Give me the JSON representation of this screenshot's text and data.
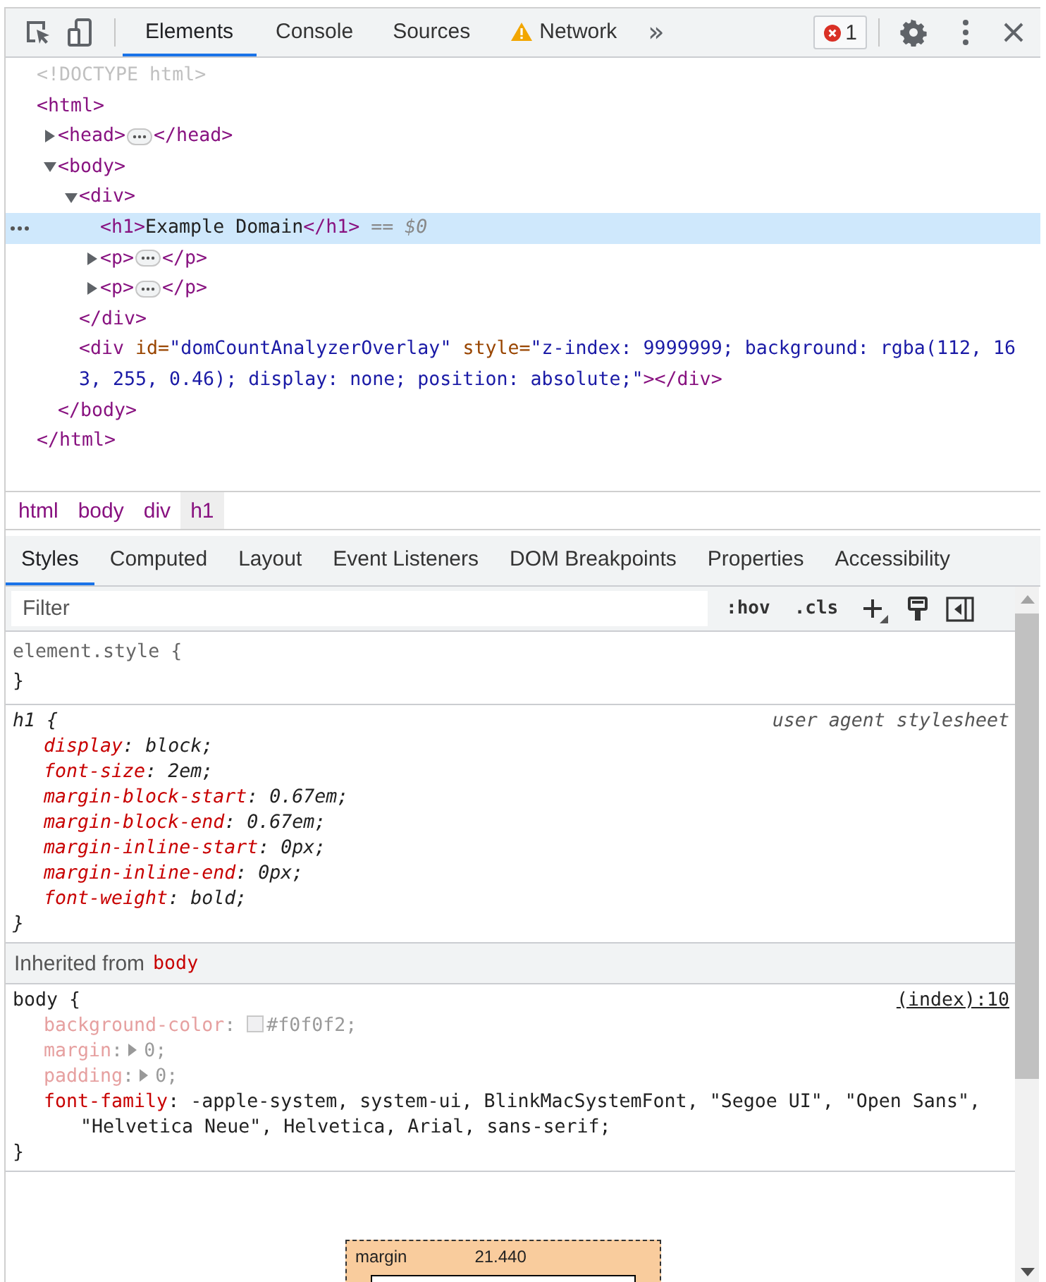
{
  "toolbar": {
    "tabs": [
      {
        "label": "Elements",
        "selected": true,
        "kind": "plain"
      },
      {
        "label": "Console",
        "selected": false,
        "kind": "plain"
      },
      {
        "label": "Sources",
        "selected": false,
        "kind": "plain"
      },
      {
        "label": "Network",
        "selected": false,
        "kind": "warning"
      }
    ],
    "more": "»",
    "error_count": "1"
  },
  "dom_tree": [
    {
      "selected": false,
      "parts": [
        {
          "kind": "doctype",
          "text": "<!DOCTYPE html>"
        }
      ]
    },
    {
      "selected": false,
      "parts": [
        {
          "kind": "tag",
          "text": "<html>"
        }
      ],
      "closing": [
        {
          "kind": "tag",
          "text": "</html>"
        }
      ],
      "children": [
        {
          "expanded": false,
          "selected": false,
          "parts": [
            {
              "kind": "tag",
              "text": "<head>"
            },
            {
              "kind": "ellipsis"
            },
            {
              "kind": "tag",
              "text": "</head>"
            }
          ]
        },
        {
          "expanded": true,
          "selected": false,
          "parts": [
            {
              "kind": "tag",
              "text": "<body>"
            }
          ],
          "closing": [
            {
              "kind": "tag",
              "text": "</body>"
            }
          ],
          "children": [
            {
              "expanded": true,
              "selected": false,
              "parts": [
                {
                  "kind": "tag",
                  "text": "<div>"
                }
              ],
              "closing": [
                {
                  "kind": "tag",
                  "text": "</div>"
                }
              ],
              "children": [
                {
                  "selected": true,
                  "parts": [
                    {
                      "kind": "tag",
                      "text": "<h1>"
                    },
                    {
                      "kind": "text",
                      "text": "Example Domain"
                    },
                    {
                      "kind": "tag",
                      "text": "</h1>"
                    },
                    {
                      "kind": "ref",
                      "text": " == $0"
                    }
                  ]
                },
                {
                  "expanded": false,
                  "selected": false,
                  "parts": [
                    {
                      "kind": "tag",
                      "text": "<p>"
                    },
                    {
                      "kind": "ellipsis"
                    },
                    {
                      "kind": "tag",
                      "text": "</p>"
                    }
                  ]
                },
                {
                  "expanded": false,
                  "selected": false,
                  "parts": [
                    {
                      "kind": "tag",
                      "text": "<p>"
                    },
                    {
                      "kind": "ellipsis"
                    },
                    {
                      "kind": "tag",
                      "text": "</p>"
                    }
                  ]
                }
              ]
            },
            {
              "selected": false,
              "parts": [
                {
                  "kind": "tag",
                  "text": "<div"
                },
                {
                  "kind": "attr",
                  "text": " id="
                },
                {
                  "kind": "value",
                  "text": "\"domCountAnalyzerOverlay\""
                },
                {
                  "kind": "attr",
                  "text": " style="
                },
                {
                  "kind": "value",
                  "text": "\"z-index: 9999999; background: rgba(112, 163, 255, 0.46); display: none; position: absolute;\""
                },
                {
                  "kind": "tag",
                  "text": "></div>"
                }
              ]
            }
          ]
        }
      ]
    }
  ],
  "breadcrumbs": [
    {
      "label": "html",
      "selected": false
    },
    {
      "label": "body",
      "selected": false
    },
    {
      "label": "div",
      "selected": false
    },
    {
      "label": "h1",
      "selected": true
    }
  ],
  "sidebar_tabs": [
    {
      "label": "Styles",
      "selected": true
    },
    {
      "label": "Computed",
      "selected": false
    },
    {
      "label": "Layout",
      "selected": false
    },
    {
      "label": "Event Listeners",
      "selected": false
    },
    {
      "label": "DOM Breakpoints",
      "selected": false
    },
    {
      "label": "Properties",
      "selected": false
    },
    {
      "label": "Accessibility",
      "selected": false
    }
  ],
  "filter": {
    "placeholder": "Filter"
  },
  "filter_buttons": [
    ":hov",
    ".cls"
  ],
  "rules": [
    {
      "kind": "inline",
      "selector": "element.style",
      "open": "{",
      "close": "}"
    },
    {
      "kind": "user-agent",
      "selector": "h1",
      "open": "{",
      "close": "}",
      "source": "user agent stylesheet",
      "declarations": [
        {
          "kind": "plain",
          "inactive": false,
          "property": "display",
          "separator": ":",
          "value": "block;"
        },
        {
          "kind": "plain",
          "inactive": false,
          "property": "font-size",
          "separator": ":",
          "value": "2em;"
        },
        {
          "kind": "plain",
          "inactive": false,
          "property": "margin-block-start",
          "separator": ":",
          "value": "0.67em;"
        },
        {
          "kind": "plain",
          "inactive": false,
          "property": "margin-block-end",
          "separator": ":",
          "value": "0.67em;"
        },
        {
          "kind": "plain",
          "inactive": false,
          "property": "margin-inline-start",
          "separator": ":",
          "value": "0px;"
        },
        {
          "kind": "plain",
          "inactive": false,
          "property": "margin-inline-end",
          "separator": ":",
          "value": "0px;"
        },
        {
          "kind": "plain",
          "inactive": false,
          "property": "font-weight",
          "separator": ":",
          "value": "bold;"
        }
      ]
    },
    {
      "kind": "inherited-header",
      "label": "Inherited from",
      "selector": "body"
    },
    {
      "kind": "author",
      "selector": "body",
      "open": "{",
      "close": "}",
      "source": "(index):10",
      "declarations": [
        {
          "kind": "color",
          "inactive": true,
          "property": "background-color",
          "separator": ":",
          "value": "#f0f0f2;"
        },
        {
          "kind": "shorthand",
          "inactive": true,
          "property": "margin",
          "separator": ":",
          "value": "0;"
        },
        {
          "kind": "shorthand",
          "inactive": true,
          "property": "padding",
          "separator": ":",
          "value": "0;"
        },
        {
          "kind": "plain",
          "inactive": false,
          "property": "font-family",
          "separator": ":",
          "value": "-apple-system, system-ui, BlinkMacSystemFont, \"Segoe UI\", \"Open Sans\", \"Helvetica Neue\", Helvetica, Arial, sans-serif;"
        }
      ]
    }
  ],
  "box_model": {
    "label": "margin",
    "value": "21.440"
  }
}
